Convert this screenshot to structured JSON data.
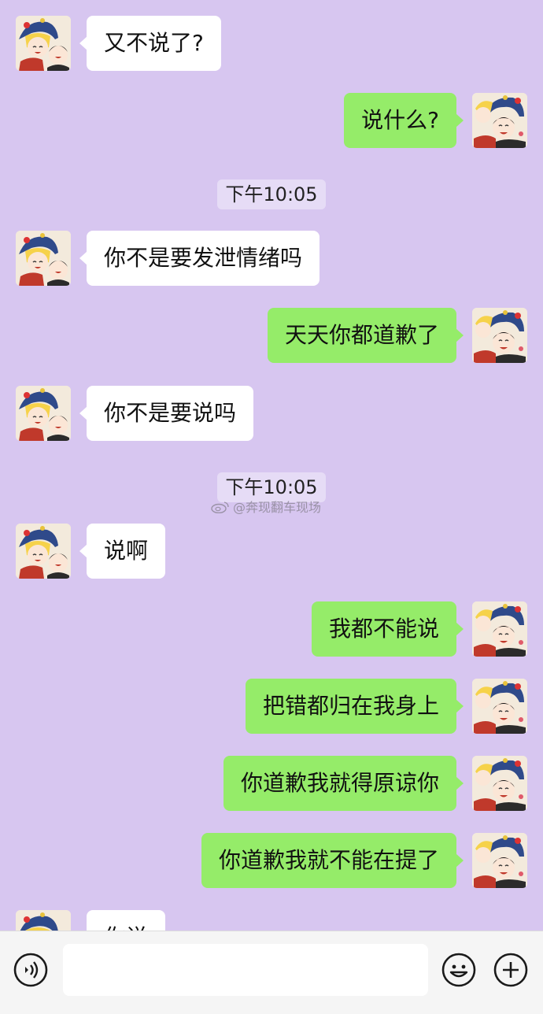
{
  "messages": [
    {
      "side": "left",
      "text": "又不说了?"
    },
    {
      "side": "right",
      "text": "说什么?"
    },
    {
      "side": "time",
      "text": "下午10:05"
    },
    {
      "side": "left",
      "text": "你不是要发泄情绪吗"
    },
    {
      "side": "right",
      "text": "天天你都道歉了"
    },
    {
      "side": "left",
      "text": "你不是要说吗"
    },
    {
      "side": "time",
      "text": "下午10:05"
    },
    {
      "side": "left",
      "text": "说啊"
    },
    {
      "side": "right",
      "text": "我都不能说"
    },
    {
      "side": "right",
      "text": "把错都归在我身上"
    },
    {
      "side": "right",
      "text": "你道歉我就得原谅你"
    },
    {
      "side": "right",
      "text": "你道歉我就不能在提了"
    },
    {
      "side": "left",
      "text": "你说"
    }
  ],
  "watermark": "@奔现翻车现场",
  "input": {
    "value": "",
    "placeholder": ""
  },
  "icons": {
    "voice": "voice-icon",
    "emoji": "emoji-icon",
    "plus": "plus-icon"
  },
  "colors": {
    "background": "#d7c6f0",
    "sent_bubble": "#95ec69",
    "received_bubble": "#ffffff",
    "time_badge": "#e6dcf6",
    "input_bar": "#f5f5f5"
  }
}
